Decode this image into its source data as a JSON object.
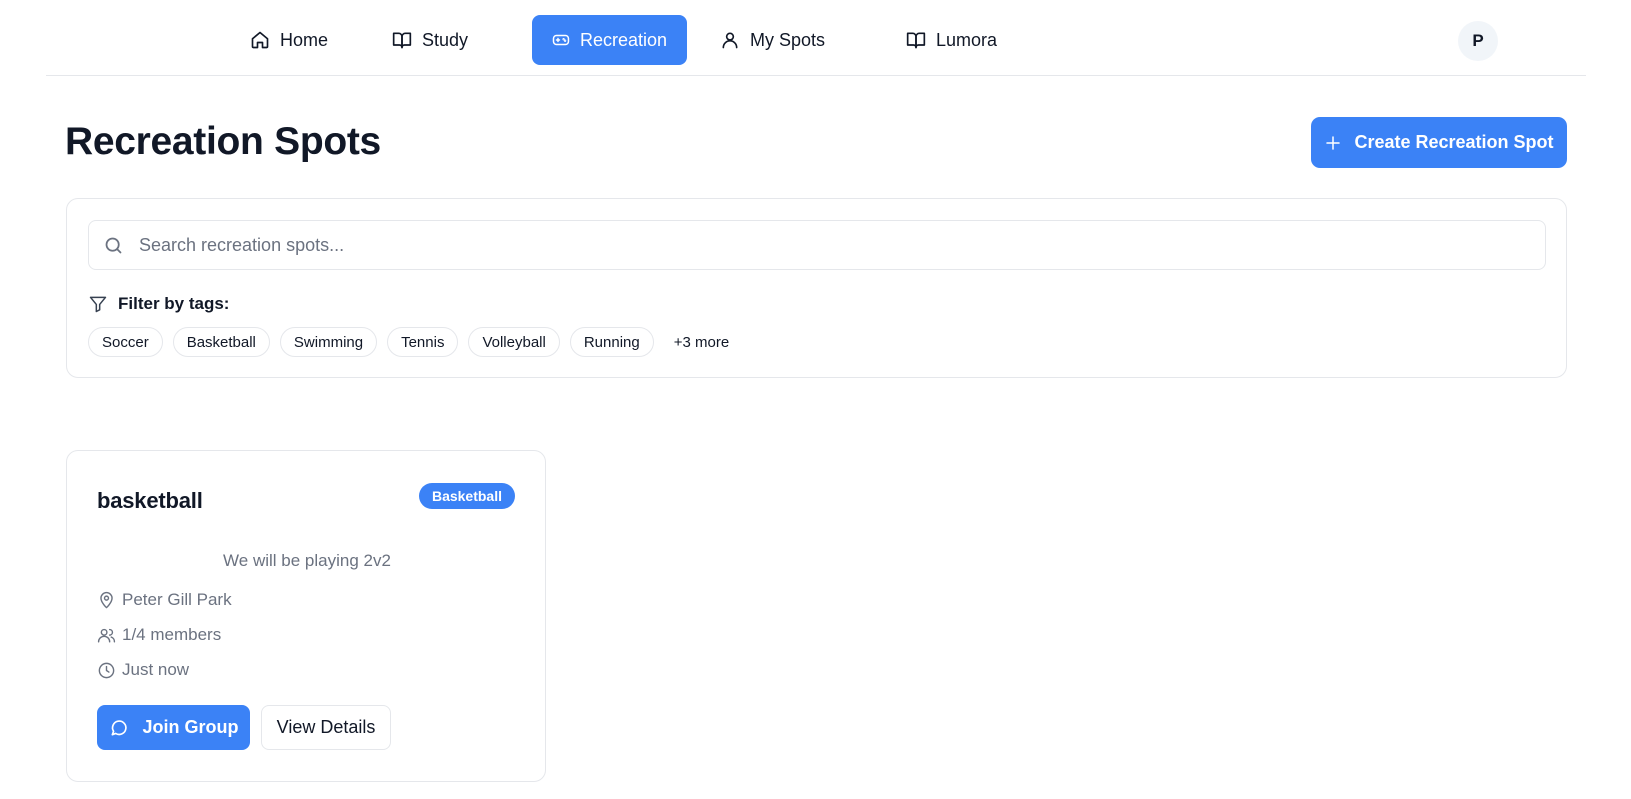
{
  "nav": {
    "items": [
      {
        "label": "Home",
        "icon": "home-icon"
      },
      {
        "label": "Study",
        "icon": "book-icon"
      },
      {
        "label": "Recreation",
        "icon": "gamepad-icon",
        "active": true
      },
      {
        "label": "My Spots",
        "icon": "user-icon"
      },
      {
        "label": "Lumora",
        "icon": "book-icon"
      }
    ],
    "avatar_initial": "P"
  },
  "header": {
    "title": "Recreation Spots",
    "create_label": "Create Recreation Spot"
  },
  "search": {
    "placeholder": "Search recreation spots...",
    "value": "",
    "filter_label": "Filter by tags:",
    "tags": [
      "Soccer",
      "Basketball",
      "Swimming",
      "Tennis",
      "Volleyball",
      "Running"
    ],
    "more_label": "+3 more"
  },
  "spots": [
    {
      "title": "basketball",
      "tag": "Basketball",
      "description": "We will be playing 2v2",
      "location": "Peter Gill Park",
      "members": "1/4 members",
      "time": "Just now",
      "join_label": "Join Group",
      "details_label": "View Details"
    }
  ],
  "colors": {
    "accent": "#3b82f6",
    "border": "#e5e7eb",
    "muted_text": "#6b7280",
    "text": "#111827"
  }
}
